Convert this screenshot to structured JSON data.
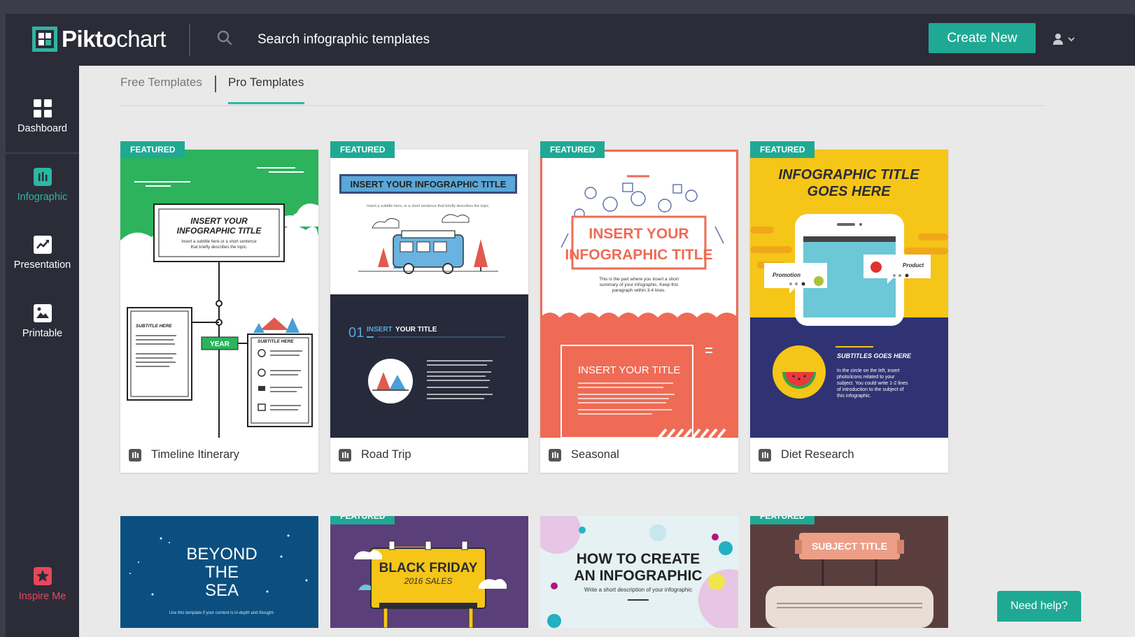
{
  "app": {
    "logo_bold": "Pikto",
    "logo_light": "chart"
  },
  "header": {
    "search_placeholder": "Search infographic templates",
    "create_label": "Create New"
  },
  "sidebar": {
    "items": [
      {
        "label": "Dashboard",
        "icon": "grid-icon"
      },
      {
        "label": "Infographic",
        "icon": "infographic-icon"
      },
      {
        "label": "Presentation",
        "icon": "presentation-icon"
      },
      {
        "label": "Printable",
        "icon": "image-icon"
      },
      {
        "label": "Inspire Me",
        "icon": "star-icon"
      }
    ]
  },
  "tabs": [
    {
      "label": "Free Templates"
    },
    {
      "label": "Pro Templates"
    }
  ],
  "badge_label": "FEATURED",
  "cards": [
    {
      "name": "Timeline Itinerary",
      "featured": true,
      "title_line1": "INSERT YOUR",
      "title_line2": "INFOGRAPHIC TITLE",
      "sub1": "Insert a subtitle here or a short sentence",
      "sub2": "that briefly describes the topic.",
      "year": "YEAR",
      "subtitle_left": "SUBTITLE HERE",
      "subtitle_right": "SUBTITLE HERE"
    },
    {
      "name": "Road Trip",
      "featured": true,
      "title": "INSERT YOUR INFOGRAPHIC TITLE",
      "sub": "Insert a subtitle here, or a short sentence that briefly describes the topic.",
      "num": "01",
      "sec_title_a": "INSERT",
      "sec_title_b": "YOUR TITLE"
    },
    {
      "name": "Seasonal",
      "featured": true,
      "title_line1": "INSERT YOUR",
      "title_line2": "INFOGRAPHIC TITLE",
      "desc1": "This is the part where you insert a short",
      "desc2": "summary of your infographic. Keep this",
      "desc3": "paragraph within 3-4 lines.",
      "sec_title": "INSERT YOUR TITLE"
    },
    {
      "name": "Diet Research",
      "featured": true,
      "title_line1": "INFOGRAPHIC TITLE",
      "title_line2": "GOES HERE",
      "promo": "Promotion",
      "product": "Product",
      "sub_title": "SUBTITLES GOES HERE",
      "desc1": "In the circle on the left, insert",
      "desc2": "photo/icons related to your",
      "desc3": "subject. You could write 1-2 lines",
      "desc4": "of introduction to the subject of",
      "desc5": "this infographic."
    }
  ],
  "cards_row2": [
    {
      "featured": false,
      "line1": "BEYOND",
      "line2": "THE",
      "line3": "SEA",
      "note": "Use this template if your content is in-depth and thought-"
    },
    {
      "featured": true,
      "line1": "BLACK FRIDAY",
      "line2": "2016 SALES"
    },
    {
      "featured": false,
      "line1": "HOW TO CREATE",
      "line2": "AN INFOGRAPHIC",
      "line3": "Write a short description of your infographic"
    },
    {
      "featured": true,
      "line1": "SUBJECT TITLE"
    }
  ],
  "help": {
    "label": "Need help?"
  }
}
